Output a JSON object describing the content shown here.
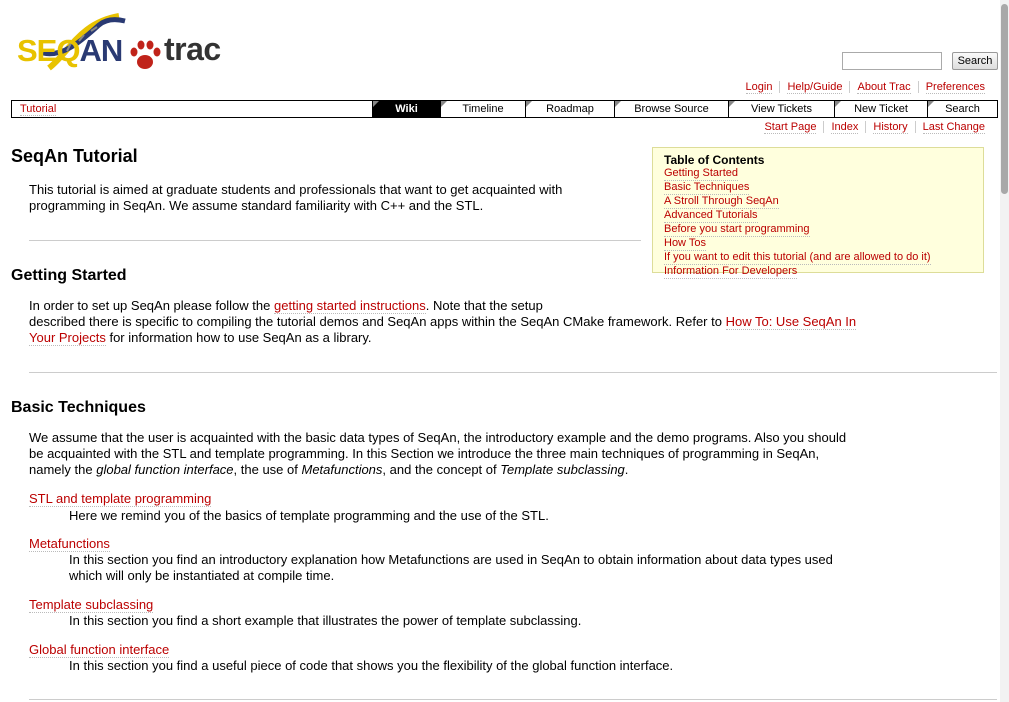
{
  "header": {
    "logo_text_1": "SEQ",
    "logo_text_2": "AN",
    "logo_trac": "trac",
    "search_button": "Search",
    "search_value": ""
  },
  "metanav": [
    "Login",
    "Help/Guide",
    "About Trac",
    "Preferences"
  ],
  "mainnav": {
    "breadcrumb": "Tutorial",
    "tabs": [
      "Wiki",
      "Timeline",
      "Roadmap",
      "Browse Source",
      "View Tickets",
      "New Ticket",
      "Search"
    ],
    "active_tab": "Wiki"
  },
  "ctxtnav": [
    "Start Page",
    "Index",
    "History",
    "Last Change"
  ],
  "page": {
    "title": "SeqAn Tutorial",
    "intro": "This tutorial is aimed at graduate students and professionals that want to get acquainted with programming in SeqAn. We assume standard familiarity with C++ and the STL."
  },
  "toc": {
    "title": "Table of Contents",
    "items": [
      "Getting Started",
      "Basic Techniques",
      "A Stroll Through SeqAn",
      "Advanced Tutorials",
      "Before you start programming",
      "How Tos",
      "If you want to edit this tutorial (and are allowed to do it)",
      "Information For Developers"
    ]
  },
  "getting_started": {
    "heading": "Getting Started",
    "text_1": "In order to set up SeqAn please follow the",
    "link_1": "getting started instructions",
    "text_2": ". Note that the setup",
    "text_3": "described there is specific to compiling the tutorial demos and SeqAn apps within the SeqAn CMake framework. Refer to",
    "link_2a": "How To: Use SeqAn In",
    "link_2b": "Your Projects",
    "text_4": "for information how to use SeqAn as a library."
  },
  "basic_techniques": {
    "heading": "Basic Techniques",
    "line_1": "We assume that the user is acquainted with the basic data types of SeqAn, the introductory example and the demo programs. Also you should",
    "line_2": "be acquainted with the STL and template programming. In this Section we introduce the three main techniques of programming in SeqAn,",
    "line_3a": "namely the",
    "line_3b": "global function interface",
    "line_3c": ", the use of",
    "line_3d": "Metafunctions",
    "line_3e": ", and the concept of",
    "line_3f": "Template subclassing",
    "line_3g": ".",
    "items": [
      {
        "term": "STL and template programming",
        "desc_1": "Here we remind you of the basics of template programming and the use of the STL.",
        "desc_2": ""
      },
      {
        "term": "Metafunctions",
        "desc_1": "In this section you find an introductory explanation how Metafunctions are used in SeqAn to obtain information about data types used",
        "desc_2": "which will only be instantiated at compile time."
      },
      {
        "term": "Template subclassing",
        "desc_1": "In this section you find a short example that illustrates the power of template subclassing.",
        "desc_2": ""
      },
      {
        "term": "Global function interface",
        "desc_1": "In this section you find a useful piece of code that shows you the flexibility of the global function interface.",
        "desc_2": ""
      }
    ]
  },
  "colors": {
    "link": "#bb0000",
    "toc_bg": "#ffffdd",
    "active_tab_bg": "#000000"
  }
}
